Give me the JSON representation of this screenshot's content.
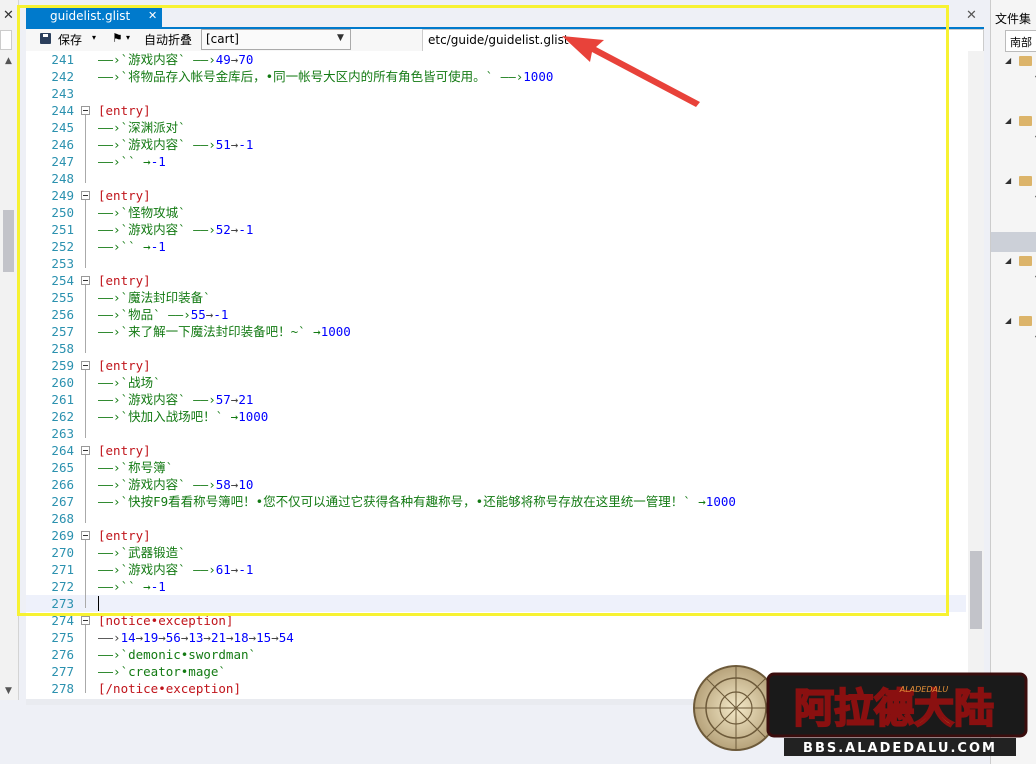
{
  "tab": {
    "title": "guidelist.glist",
    "close": "✕"
  },
  "toolbar": {
    "save_label": "保存",
    "dropdown_glyph": "▾",
    "format_glyph": "⚑",
    "auto_fold_label": "自动折叠",
    "section_select": "[cart]",
    "file_path": "etc/guide/guidelist.glist"
  },
  "right_panel": {
    "title": "文件集",
    "tab_label": "南部"
  },
  "lines": [
    {
      "no": "241",
      "segs": [
        [
          "——›`游戏内容` ——›",
          "g"
        ],
        [
          "49",
          "b"
        ],
        [
          "→",
          "a"
        ],
        [
          "70",
          "b"
        ]
      ]
    },
    {
      "no": "242",
      "segs": [
        [
          "——›`将物品存入帐号金库后，•同一帐号大区内的所有角色皆可使用。` ——›",
          "g"
        ],
        [
          "1000",
          "b"
        ]
      ]
    },
    {
      "no": "243",
      "segs": []
    },
    {
      "no": "244",
      "fold": true,
      "segs": [
        [
          "[entry]",
          "r"
        ]
      ]
    },
    {
      "no": "245",
      "segs": [
        [
          "——›`深渊派对`",
          "g"
        ]
      ]
    },
    {
      "no": "246",
      "segs": [
        [
          "——›`游戏内容` ——›",
          "g"
        ],
        [
          "51",
          "b"
        ],
        [
          "→",
          "a"
        ],
        [
          "-1",
          "b"
        ]
      ]
    },
    {
      "no": "247",
      "segs": [
        [
          "——›`` →",
          "g"
        ],
        [
          "-1",
          "b"
        ]
      ]
    },
    {
      "no": "248",
      "segs": []
    },
    {
      "no": "249",
      "fold": true,
      "segs": [
        [
          "[entry]",
          "r"
        ]
      ]
    },
    {
      "no": "250",
      "segs": [
        [
          "——›`怪物攻城`",
          "g"
        ]
      ]
    },
    {
      "no": "251",
      "segs": [
        [
          "——›`游戏内容` ——›",
          "g"
        ],
        [
          "52",
          "b"
        ],
        [
          "→",
          "a"
        ],
        [
          "-1",
          "b"
        ]
      ]
    },
    {
      "no": "252",
      "segs": [
        [
          "——›`` →",
          "g"
        ],
        [
          "-1",
          "b"
        ]
      ]
    },
    {
      "no": "253",
      "segs": []
    },
    {
      "no": "254",
      "fold": true,
      "segs": [
        [
          "[entry]",
          "r"
        ]
      ]
    },
    {
      "no": "255",
      "segs": [
        [
          "——›`魔法封印装备`",
          "g"
        ]
      ]
    },
    {
      "no": "256",
      "segs": [
        [
          "——›`物品` ——›",
          "g"
        ],
        [
          "55",
          "b"
        ],
        [
          "→",
          "a"
        ],
        [
          "-1",
          "b"
        ]
      ]
    },
    {
      "no": "257",
      "segs": [
        [
          "——›`来了解一下魔法封印装备吧！~` →",
          "g"
        ],
        [
          "1000",
          "b"
        ]
      ]
    },
    {
      "no": "258",
      "segs": []
    },
    {
      "no": "259",
      "fold": true,
      "segs": [
        [
          "[entry]",
          "r"
        ]
      ]
    },
    {
      "no": "260",
      "segs": [
        [
          "——›`战场`",
          "g"
        ]
      ]
    },
    {
      "no": "261",
      "segs": [
        [
          "——›`游戏内容` ——›",
          "g"
        ],
        [
          "57",
          "b"
        ],
        [
          "→",
          "a"
        ],
        [
          "21",
          "b"
        ]
      ]
    },
    {
      "no": "262",
      "segs": [
        [
          "——›`快加入战场吧！` →",
          "g"
        ],
        [
          "1000",
          "b"
        ]
      ]
    },
    {
      "no": "263",
      "segs": []
    },
    {
      "no": "264",
      "fold": true,
      "segs": [
        [
          "[entry]",
          "r"
        ]
      ]
    },
    {
      "no": "265",
      "segs": [
        [
          "——›`称号簿`",
          "g"
        ]
      ]
    },
    {
      "no": "266",
      "segs": [
        [
          "——›`游戏内容` ——›",
          "g"
        ],
        [
          "58",
          "b"
        ],
        [
          "→",
          "a"
        ],
        [
          "10",
          "b"
        ]
      ]
    },
    {
      "no": "267",
      "segs": [
        [
          "——›`快按F9看看称号簿吧！•您不仅可以通过它获得各种有趣称号，•还能够将称号存放在这里统一管理！` →",
          "g"
        ],
        [
          "1000",
          "b"
        ]
      ]
    },
    {
      "no": "268",
      "segs": []
    },
    {
      "no": "269",
      "fold": true,
      "segs": [
        [
          "[entry]",
          "r"
        ]
      ]
    },
    {
      "no": "270",
      "segs": [
        [
          "——›`武器锻造`",
          "g"
        ]
      ]
    },
    {
      "no": "271",
      "segs": [
        [
          "——›`游戏内容` ——›",
          "g"
        ],
        [
          "61",
          "b"
        ],
        [
          "→",
          "a"
        ],
        [
          "-1",
          "b"
        ]
      ]
    },
    {
      "no": "272",
      "segs": [
        [
          "——›`` →",
          "g"
        ],
        [
          "-1",
          "b"
        ]
      ]
    },
    {
      "no": "273",
      "current": true,
      "segs": []
    },
    {
      "no": "274",
      "fold": true,
      "segs": [
        [
          "[notice•exception]",
          "r"
        ]
      ]
    },
    {
      "no": "275",
      "segs": [
        [
          "——›",
          "a"
        ],
        [
          "14",
          "b"
        ],
        [
          "→",
          "a"
        ],
        [
          "19",
          "b"
        ],
        [
          "→",
          "a"
        ],
        [
          "56",
          "b"
        ],
        [
          "→",
          "a"
        ],
        [
          "13",
          "b"
        ],
        [
          "→",
          "a"
        ],
        [
          "21",
          "b"
        ],
        [
          "→",
          "a"
        ],
        [
          "18",
          "b"
        ],
        [
          "→",
          "a"
        ],
        [
          "15",
          "b"
        ],
        [
          "→",
          "a"
        ],
        [
          "54",
          "b"
        ]
      ]
    },
    {
      "no": "276",
      "segs": [
        [
          "——›`demonic•swordman`",
          "g"
        ]
      ]
    },
    {
      "no": "277",
      "segs": [
        [
          "——›`creator•mage`",
          "g"
        ]
      ]
    },
    {
      "no": "278",
      "segs": [
        [
          "[/notice•exception]",
          "r"
        ]
      ]
    }
  ],
  "logo": {
    "title": "阿拉德大陆",
    "url_text": "BBS.ALADEDALU.COM",
    "emblem": "ALADEDALU"
  },
  "colors": {
    "accent": "#007acc",
    "highlight_box": "#f7f232",
    "annotation_arrow": "#e8423a"
  }
}
